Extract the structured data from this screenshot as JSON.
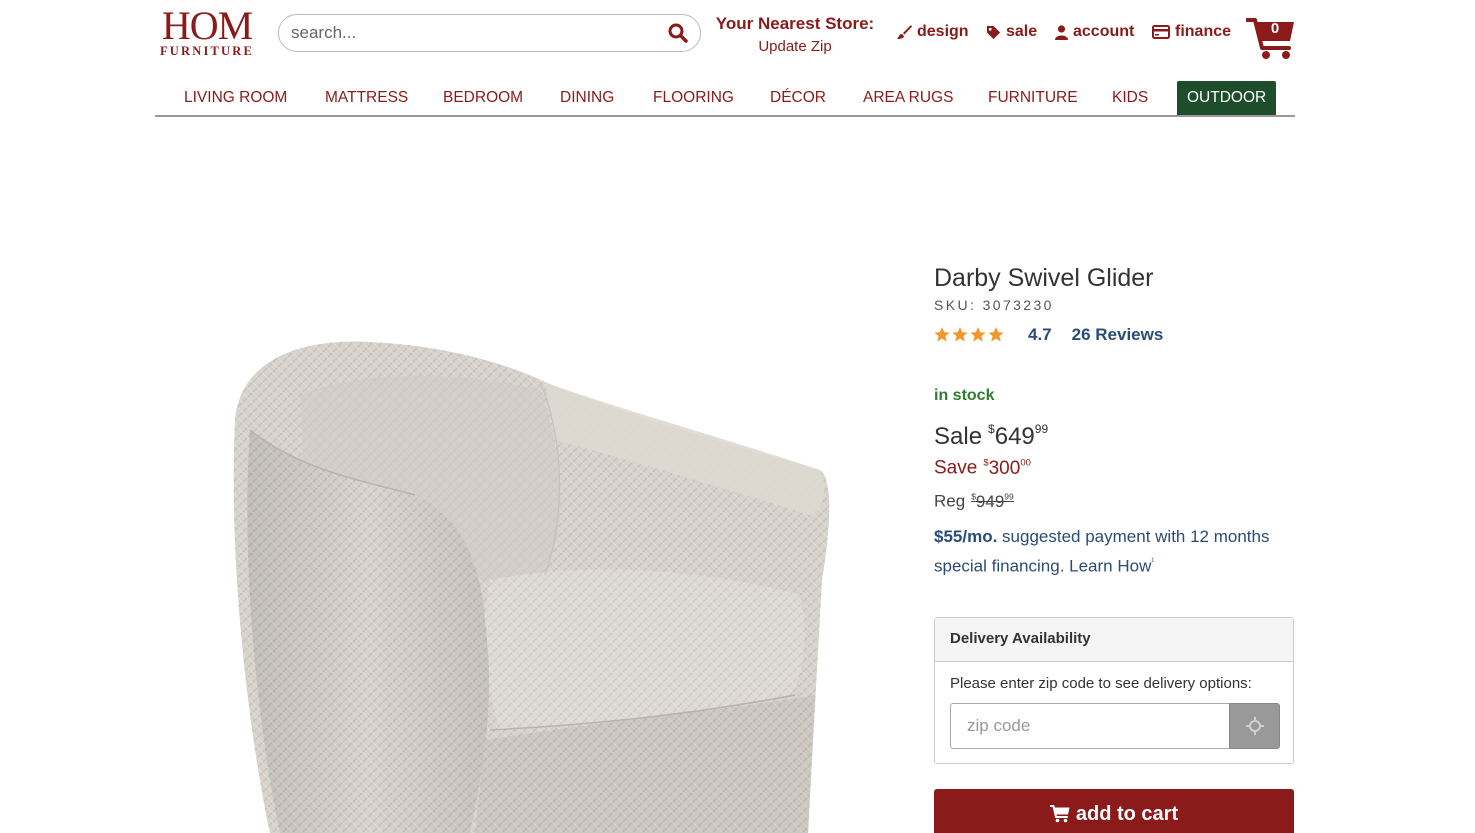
{
  "logo": {
    "line1": "HOM",
    "line2": "FURNITURE"
  },
  "search": {
    "placeholder": "search..."
  },
  "store": {
    "title": "Your Nearest Store:",
    "link": "Update Zip"
  },
  "utility": {
    "design": "design",
    "sale": "sale",
    "account": "account",
    "finance": "finance"
  },
  "cart": {
    "count": "0"
  },
  "nav": {
    "items": [
      "LIVING ROOM",
      "MATTRESS",
      "BEDROOM",
      "DINING",
      "FLOORING",
      "DÉCOR",
      "AREA RUGS",
      "FURNITURE",
      "KIDS",
      "OUTDOOR"
    ],
    "active": "OUTDOOR"
  },
  "product": {
    "title": "Darby Swivel Glider",
    "sku": "SKU: 3073230",
    "rating": 4.7,
    "rating_text": "4.7",
    "reviews": "26 Reviews",
    "stock": "in stock",
    "sale": {
      "label": "Sale",
      "currency": "$",
      "dollars": "649",
      "cents": "99"
    },
    "save": {
      "label": "Save",
      "currency": "$",
      "dollars": "300",
      "cents": "00"
    },
    "reg": {
      "label": "Reg",
      "currency": "$",
      "dollars": "949",
      "cents": "99"
    },
    "financing": {
      "amount": "$55/mo.",
      "text": " suggested payment with 12 months special financing. Learn How",
      "mark": "¹"
    }
  },
  "delivery": {
    "heading": "Delivery Availability",
    "prompt": "Please enter zip code to see delivery options:",
    "zip_placeholder": "zip code"
  },
  "add_to_cart": "add to cart",
  "colors": {
    "brand": "#8b1a1a",
    "nav_active": "#1e4d2b",
    "link": "#2a4d78",
    "stock": "#2e7d32",
    "star": "#f0962a"
  },
  "icons": [
    "search-icon",
    "brush-icon",
    "tag-icon",
    "user-icon",
    "credit-card-icon",
    "cart-icon",
    "star-icon",
    "crosshair-icon"
  ]
}
